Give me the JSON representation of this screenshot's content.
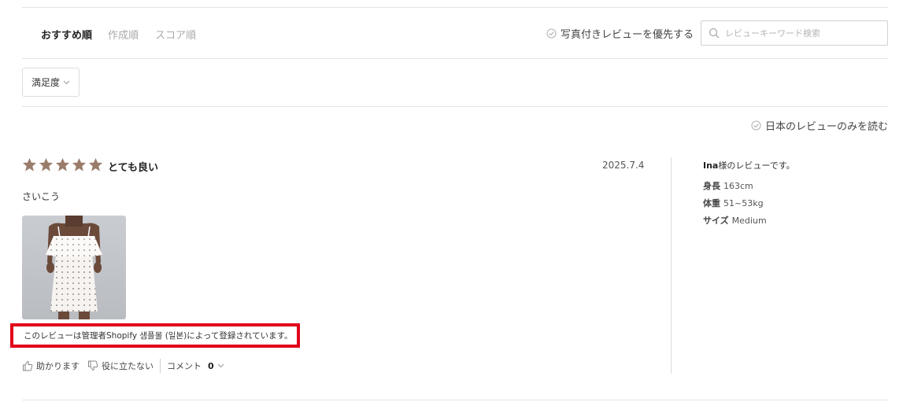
{
  "sort": {
    "tabs": [
      {
        "label": "おすすめ順",
        "active": true
      },
      {
        "label": "作成順",
        "active": false
      },
      {
        "label": "スコア順",
        "active": false
      }
    ],
    "photo_priority_label": "写真付きレビューを優先する",
    "search_placeholder": "レビューキーワード検索"
  },
  "filter": {
    "satisfaction_label": "満足度"
  },
  "japan_only_label": "日本のレビューのみを読む",
  "review": {
    "rating": 5,
    "rating_label": "とても良い",
    "date": "2025.7.4",
    "body": "さいこう",
    "admin_note": "このレビューは管理者Shopify 샘플몰 (일본)によって登録されています。",
    "actions": {
      "helpful_label": "助かります",
      "not_helpful_label": "役に立たない",
      "comment_label": "コメント",
      "comment_count": "0"
    }
  },
  "reviewer": {
    "name": "Ina",
    "title_suffix": "様のレビューです。",
    "attributes": [
      {
        "label": "身長",
        "value": "163cm"
      },
      {
        "label": "体重",
        "value": "51~53kg"
      },
      {
        "label": "サイズ",
        "value": "Medium"
      }
    ]
  },
  "colors": {
    "star": "#9a7c6b",
    "highlight_border": "#e0001b",
    "divider": "#e5e5e5"
  }
}
